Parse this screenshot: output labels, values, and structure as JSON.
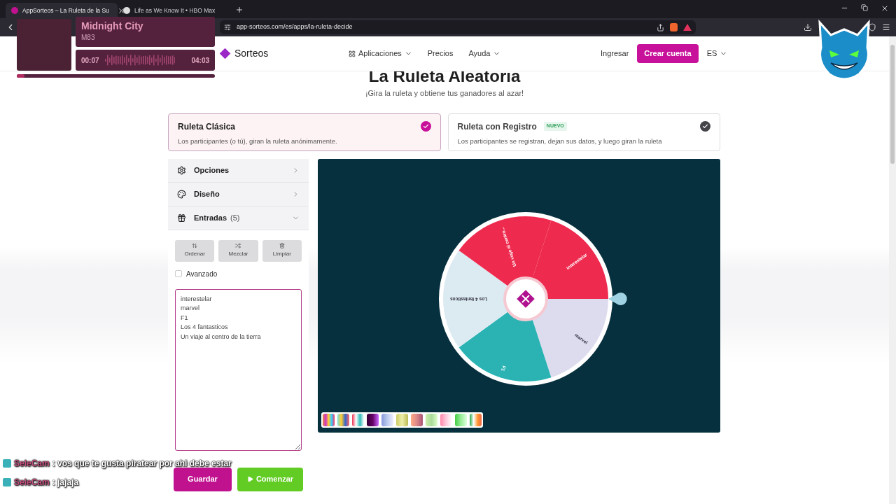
{
  "browser": {
    "tabs": [
      {
        "title": "AppSorteos – La Ruleta de la Su",
        "selected": true
      },
      {
        "title": "Life as We Know It • HBO Max",
        "selected": false
      }
    ],
    "url": "app-sorteos.com/es/apps/la-ruleta-decide"
  },
  "media_player": {
    "title": "Midnight City",
    "artist": "M83",
    "elapsed": "00:07",
    "duration": "04:03",
    "level": 0.04
  },
  "header": {
    "logo": "Sorteos",
    "nav": [
      {
        "label": "Aplicaciones",
        "kind": "menu"
      },
      {
        "label": "Precios",
        "kind": "link"
      },
      {
        "label": "Ayuda",
        "kind": "menu"
      }
    ],
    "login": "Ingresar",
    "signup": "Crear cuenta",
    "language": "ES"
  },
  "page": {
    "title": "La Ruleta Aleatoria",
    "subtitle": "¡Gira la ruleta y obtiene tus ganadores al azar!"
  },
  "modes": [
    {
      "title": "Ruleta Clásica",
      "description": "Los participantes (o tú), giran la ruleta anónimamente.",
      "selected": true
    },
    {
      "title": "Ruleta con Registro",
      "badge": "NUEVO",
      "description": "Los participantes se registran, dejan sus datos, y luego giran la ruleta",
      "selected": false
    }
  ],
  "sidebar": {
    "sections": [
      {
        "label": "Opciones",
        "expanded": false
      },
      {
        "label": "Diseño",
        "expanded": false
      },
      {
        "label": "Entradas",
        "count": "(5)",
        "expanded": true
      }
    ],
    "tools": [
      "Ordenar",
      "Mezclar",
      "Limpiar"
    ],
    "advanced": {
      "label": "Avanzado",
      "checked": false
    },
    "entries": [
      "interestelar",
      "marvel",
      "F1",
      "Los 4 fantasticos",
      "Un viaje al centro de la tierra"
    ],
    "save": "Guardar",
    "start": "Comenzar"
  },
  "wheel": {
    "segments": [
      {
        "label": "interestelar",
        "color": "#ee2a4e"
      },
      {
        "label": "marvel",
        "color": "#dcdcee"
      },
      {
        "label": "F1",
        "color": "#2bb3b3"
      },
      {
        "label": "Los 4 fantasticos",
        "color": "#dceaf1"
      },
      {
        "label": "Un viaje al centro...",
        "color": "#ee2a4e"
      }
    ]
  },
  "chat": [
    {
      "user": "SeleCam",
      "message": ": vos que te gusta piratear por ahi debe estar"
    },
    {
      "user": "SeleCam",
      "message": ": jajaja"
    }
  ]
}
